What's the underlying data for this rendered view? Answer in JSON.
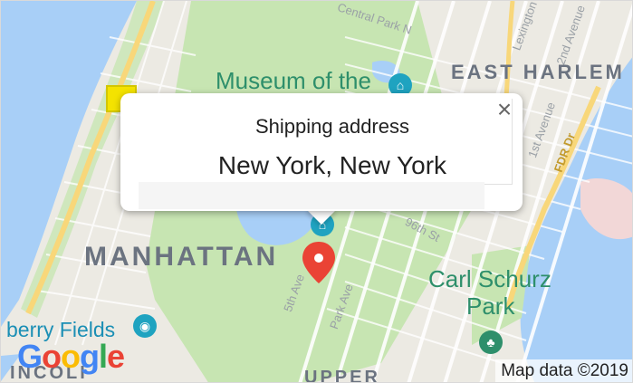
{
  "map": {
    "labels": {
      "manhattan": "MANHATTAN",
      "east_harlem": "EAST HARLEM",
      "museum": "Museum of the",
      "carl_schurz": "Carl Schurz",
      "park": "Park",
      "berry_fields": "berry Fields",
      "central_park_n": "Central Park N",
      "fifth_ave": "5th Ave",
      "park_ave": "Park Ave",
      "first_ave": "1st Avenue",
      "second_ave": "2nd Avenue",
      "fdr": "FDR Dr",
      "lexington": "Lexington",
      "street_96": "96th St",
      "upper": "UPPER",
      "lincoln": "INCOLI"
    },
    "colors": {
      "water": "#a8cff7",
      "park": "#c7e5b2",
      "land": "#eceae3",
      "highway": "#f8d77a",
      "marker": "#ea4335",
      "poi": "#2e8f6b"
    }
  },
  "infowindow": {
    "title": "Shipping address",
    "city": "New York, New York",
    "close_icon": "×"
  },
  "branding": {
    "logo_letters": [
      "G",
      "o",
      "o",
      "g",
      "l",
      "e"
    ],
    "attribution": "Map data ©2019"
  }
}
